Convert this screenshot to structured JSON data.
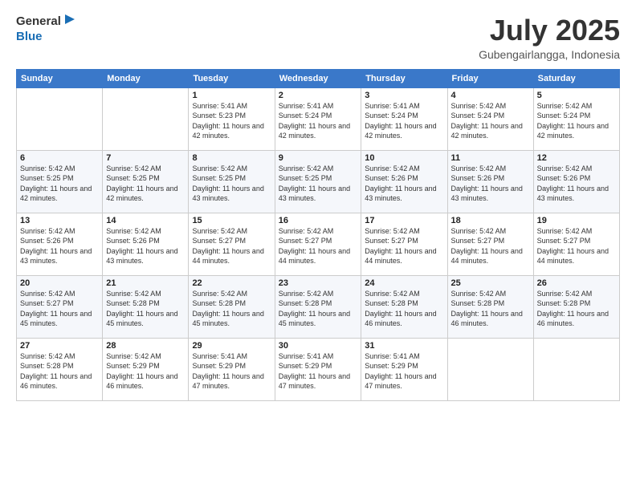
{
  "header": {
    "logo_general": "General",
    "logo_blue": "Blue",
    "title": "July 2025",
    "location": "Gubengairlangga, Indonesia"
  },
  "days_of_week": [
    "Sunday",
    "Monday",
    "Tuesday",
    "Wednesday",
    "Thursday",
    "Friday",
    "Saturday"
  ],
  "weeks": [
    [
      {
        "day": "",
        "info": ""
      },
      {
        "day": "",
        "info": ""
      },
      {
        "day": "1",
        "info": "Sunrise: 5:41 AM\nSunset: 5:23 PM\nDaylight: 11 hours and 42 minutes."
      },
      {
        "day": "2",
        "info": "Sunrise: 5:41 AM\nSunset: 5:24 PM\nDaylight: 11 hours and 42 minutes."
      },
      {
        "day": "3",
        "info": "Sunrise: 5:41 AM\nSunset: 5:24 PM\nDaylight: 11 hours and 42 minutes."
      },
      {
        "day": "4",
        "info": "Sunrise: 5:42 AM\nSunset: 5:24 PM\nDaylight: 11 hours and 42 minutes."
      },
      {
        "day": "5",
        "info": "Sunrise: 5:42 AM\nSunset: 5:24 PM\nDaylight: 11 hours and 42 minutes."
      }
    ],
    [
      {
        "day": "6",
        "info": "Sunrise: 5:42 AM\nSunset: 5:25 PM\nDaylight: 11 hours and 42 minutes."
      },
      {
        "day": "7",
        "info": "Sunrise: 5:42 AM\nSunset: 5:25 PM\nDaylight: 11 hours and 42 minutes."
      },
      {
        "day": "8",
        "info": "Sunrise: 5:42 AM\nSunset: 5:25 PM\nDaylight: 11 hours and 43 minutes."
      },
      {
        "day": "9",
        "info": "Sunrise: 5:42 AM\nSunset: 5:25 PM\nDaylight: 11 hours and 43 minutes."
      },
      {
        "day": "10",
        "info": "Sunrise: 5:42 AM\nSunset: 5:26 PM\nDaylight: 11 hours and 43 minutes."
      },
      {
        "day": "11",
        "info": "Sunrise: 5:42 AM\nSunset: 5:26 PM\nDaylight: 11 hours and 43 minutes."
      },
      {
        "day": "12",
        "info": "Sunrise: 5:42 AM\nSunset: 5:26 PM\nDaylight: 11 hours and 43 minutes."
      }
    ],
    [
      {
        "day": "13",
        "info": "Sunrise: 5:42 AM\nSunset: 5:26 PM\nDaylight: 11 hours and 43 minutes."
      },
      {
        "day": "14",
        "info": "Sunrise: 5:42 AM\nSunset: 5:26 PM\nDaylight: 11 hours and 43 minutes."
      },
      {
        "day": "15",
        "info": "Sunrise: 5:42 AM\nSunset: 5:27 PM\nDaylight: 11 hours and 44 minutes."
      },
      {
        "day": "16",
        "info": "Sunrise: 5:42 AM\nSunset: 5:27 PM\nDaylight: 11 hours and 44 minutes."
      },
      {
        "day": "17",
        "info": "Sunrise: 5:42 AM\nSunset: 5:27 PM\nDaylight: 11 hours and 44 minutes."
      },
      {
        "day": "18",
        "info": "Sunrise: 5:42 AM\nSunset: 5:27 PM\nDaylight: 11 hours and 44 minutes."
      },
      {
        "day": "19",
        "info": "Sunrise: 5:42 AM\nSunset: 5:27 PM\nDaylight: 11 hours and 44 minutes."
      }
    ],
    [
      {
        "day": "20",
        "info": "Sunrise: 5:42 AM\nSunset: 5:27 PM\nDaylight: 11 hours and 45 minutes."
      },
      {
        "day": "21",
        "info": "Sunrise: 5:42 AM\nSunset: 5:28 PM\nDaylight: 11 hours and 45 minutes."
      },
      {
        "day": "22",
        "info": "Sunrise: 5:42 AM\nSunset: 5:28 PM\nDaylight: 11 hours and 45 minutes."
      },
      {
        "day": "23",
        "info": "Sunrise: 5:42 AM\nSunset: 5:28 PM\nDaylight: 11 hours and 45 minutes."
      },
      {
        "day": "24",
        "info": "Sunrise: 5:42 AM\nSunset: 5:28 PM\nDaylight: 11 hours and 46 minutes."
      },
      {
        "day": "25",
        "info": "Sunrise: 5:42 AM\nSunset: 5:28 PM\nDaylight: 11 hours and 46 minutes."
      },
      {
        "day": "26",
        "info": "Sunrise: 5:42 AM\nSunset: 5:28 PM\nDaylight: 11 hours and 46 minutes."
      }
    ],
    [
      {
        "day": "27",
        "info": "Sunrise: 5:42 AM\nSunset: 5:28 PM\nDaylight: 11 hours and 46 minutes."
      },
      {
        "day": "28",
        "info": "Sunrise: 5:42 AM\nSunset: 5:29 PM\nDaylight: 11 hours and 46 minutes."
      },
      {
        "day": "29",
        "info": "Sunrise: 5:41 AM\nSunset: 5:29 PM\nDaylight: 11 hours and 47 minutes."
      },
      {
        "day": "30",
        "info": "Sunrise: 5:41 AM\nSunset: 5:29 PM\nDaylight: 11 hours and 47 minutes."
      },
      {
        "day": "31",
        "info": "Sunrise: 5:41 AM\nSunset: 5:29 PM\nDaylight: 11 hours and 47 minutes."
      },
      {
        "day": "",
        "info": ""
      },
      {
        "day": "",
        "info": ""
      }
    ]
  ]
}
